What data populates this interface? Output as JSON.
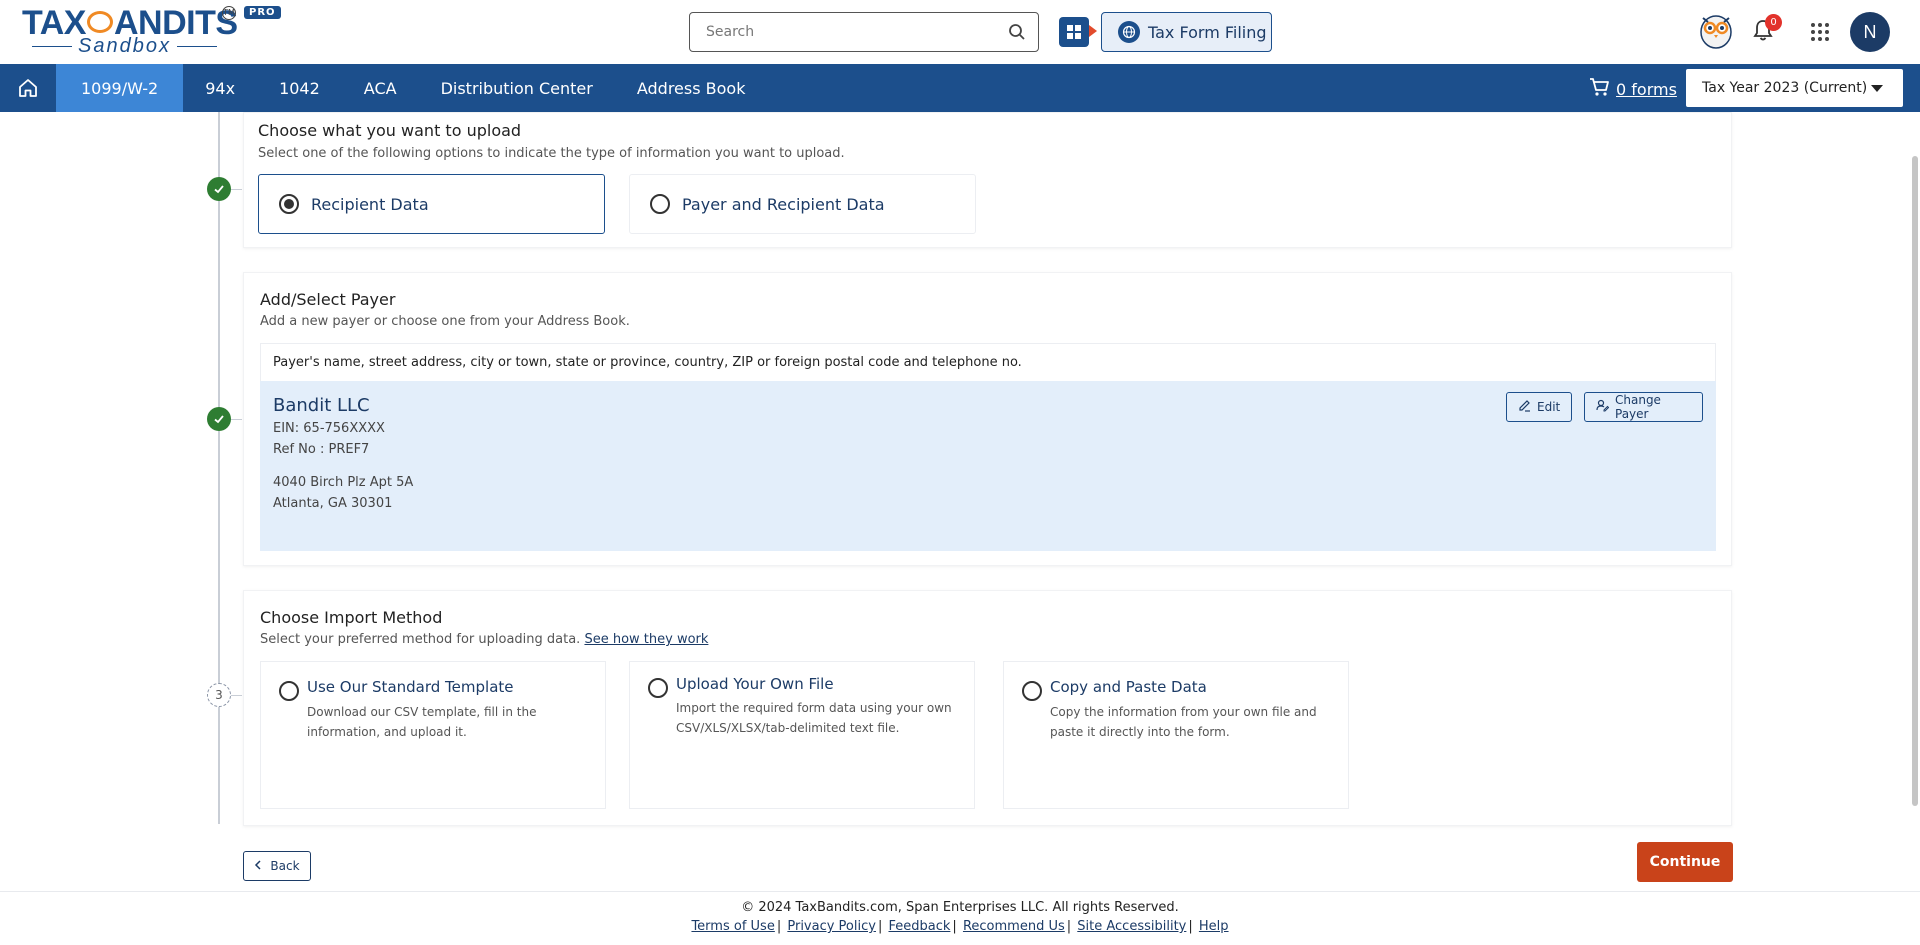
{
  "header": {
    "logo_text": "TAXBANDITS",
    "logo_sub": "Sandbox",
    "logo_tm": "TM",
    "logo_badge": "PRO",
    "search_placeholder": "Search",
    "tax_form_filing_label": "Tax Form Filing",
    "notification_count": "0",
    "user_initial": "N"
  },
  "nav": {
    "items": [
      "1099/W-2",
      "94x",
      "1042",
      "ACA",
      "Distribution Center",
      "Address Book"
    ],
    "active_index": 0,
    "cart_label": "0 forms",
    "tax_year": "Tax Year 2023 (Current)"
  },
  "upload": {
    "title": "Choose what you want to upload",
    "subtitle": "Select one of the following options to indicate the type of information you want to upload.",
    "options": [
      "Recipient Data",
      "Payer and Recipient Data"
    ],
    "selected": 0
  },
  "payer": {
    "title": "Add/Select Payer",
    "subtitle": "Add a new payer or choose one from your Address Book.",
    "table_header": "Payer's name, street address, city or town, state or province, country, ZIP or foreign postal code and telephone no.",
    "name": "Bandit LLC",
    "ein": "EIN: 65-756XXXX",
    "ref": "Ref No : PREF7",
    "address1": "4040 Birch Plz Apt 5A",
    "address2": "Atlanta, GA 30301",
    "edit_label": "Edit",
    "change_label": "Change Payer"
  },
  "import": {
    "title": "Choose Import Method",
    "subtitle": "Select your preferred method for uploading data.",
    "how_link": "See how they work",
    "step_number": "3",
    "methods": [
      {
        "title": "Use Our Standard Template",
        "desc1": "Download our CSV template, fill in the",
        "desc2": "information, and upload it."
      },
      {
        "title": "Upload Your Own File",
        "desc1": "Import the required form data using your own",
        "desc2": "CSV/XLS/XLSX/tab-delimited text file."
      },
      {
        "title": "Copy and Paste Data",
        "desc1": "Copy the information from your own file and",
        "desc2": "paste it directly into the form."
      }
    ]
  },
  "actions": {
    "back_label": "Back",
    "continue_label": "Continue"
  },
  "footer": {
    "copyright": "© 2024 TaxBandits.com, Span Enterprises LLC. All rights Reserved.",
    "links": [
      "Terms of Use",
      "Privacy Policy",
      "Feedback",
      "Recommend Us",
      "Site Accessibility",
      "Help"
    ]
  },
  "colors": {
    "brand": "#1c4f8c",
    "nav_active": "#3d86d6",
    "continue": "#c9431a",
    "success": "#2e7d32",
    "payer_bg": "#e3eefa"
  }
}
